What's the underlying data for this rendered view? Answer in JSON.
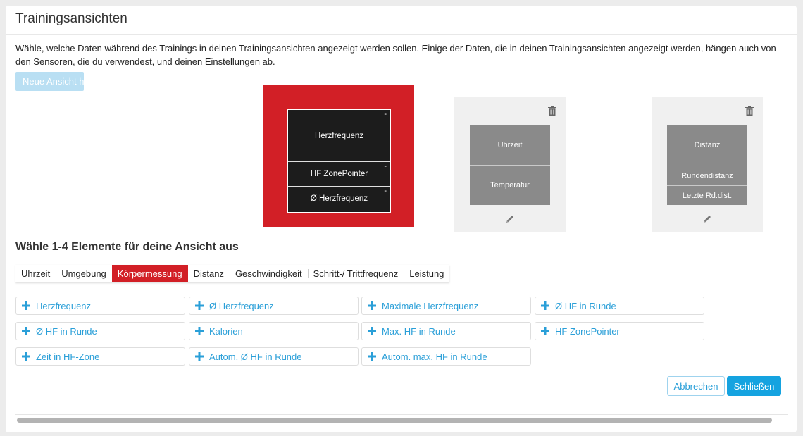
{
  "dialog": {
    "title": "Trainingsansichten",
    "description": "Wähle, welche Daten während des Trainings in deinen Trainingsansichten angezeigt werden sollen. Einige der Daten, die in deinen Trainingsansichten angezeigt werden, hängen auch von den Sensoren, die du verwendest, und deinen Einstellungen ab.",
    "new_view_label": "Neue Ansicht h"
  },
  "views": [
    {
      "selected": true,
      "fields": [
        "Herzfrequenz",
        "HF ZonePointer",
        "Ø Herzfrequenz"
      ],
      "remove_marker": "-"
    },
    {
      "selected": false,
      "fields": [
        "Uhrzeit",
        "Temperatur"
      ]
    },
    {
      "selected": false,
      "fields": [
        "Distanz",
        "Rundendistanz",
        "Letzte Rd.dist."
      ]
    }
  ],
  "picker": {
    "subtitle": "Wähle 1-4 Elemente für deine Ansicht aus",
    "tabs": [
      "Uhrzeit",
      "Umgebung",
      "Körpermessung",
      "Distanz",
      "Geschwindigkeit",
      "Schritt-/ Trittfrequenz",
      "Leistung"
    ],
    "active_tab": "Körpermessung",
    "items": [
      "Herzfrequenz",
      "Ø Herzfrequenz",
      "Maximale Herzfrequenz",
      "Ø HF in Runde",
      "Ø HF in Runde",
      "Kalorien",
      "Max. HF in Runde",
      "HF ZonePointer",
      "Zeit in HF-Zone",
      "Autom. Ø HF in Runde",
      "Autom. max. HF in Runde"
    ]
  },
  "footer": {
    "cancel_label": "Abbrechen",
    "close_label": "Schließen"
  },
  "colors": {
    "accent_red": "#d21f26",
    "link_blue": "#2a9fd8",
    "primary_button": "#15a3e0"
  },
  "icons": {
    "delete": "trash-icon",
    "edit": "pencil-icon",
    "add": "plus-icon"
  }
}
